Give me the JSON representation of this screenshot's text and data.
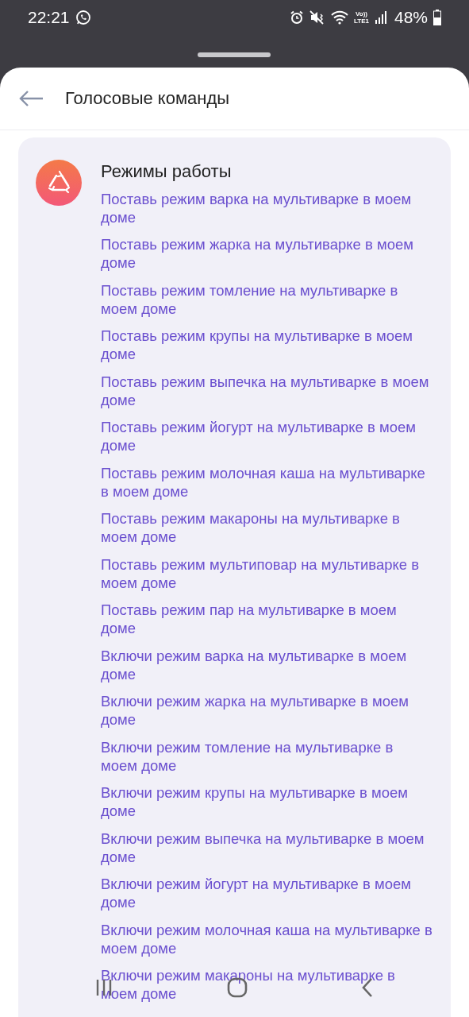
{
  "status_bar": {
    "time": "22:21",
    "network_top": "Vo))",
    "network_bottom": "LTE1",
    "battery": "48%"
  },
  "sheet": {
    "title": "Голосовые команды"
  },
  "card": {
    "title": "Режимы работы",
    "commands": [
      "Поставь режим варка на мультиварке в моем доме",
      "Поставь режим жарка на мультиварке в моем доме",
      "Поставь режим томление на мультиварке в моем доме",
      "Поставь режим крупы на мультиварке в моем доме",
      "Поставь режим выпечка на мультиварке в моем доме",
      "Поставь режим йогурт на мультиварке в моем доме",
      "Поставь режим молочная каша на мультиварке в моем доме",
      "Поставь режим макароны на мультиварке в моем доме",
      "Поставь режим мультиповар на мультиварке в моем доме",
      "Поставь режим пар на мультиварке в моем доме",
      "Включи режим варка на мультиварке в моем доме",
      "Включи режим жарка на мультиварке в моем доме",
      "Включи режим томление на мультиварке в моем доме",
      "Включи режим крупы на мультиварке в моем доме",
      "Включи режим выпечка на мультиварке в моем доме",
      "Включи режим йогурт на мультиварке в моем доме",
      "Включи режим молочная каша на мультиварке в моем доме",
      "Включи режим макароны на мультиварке в моем доме"
    ]
  }
}
